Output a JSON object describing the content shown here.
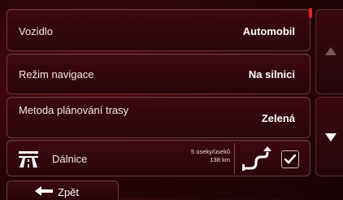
{
  "settings": {
    "vehicle": {
      "label": "Vozidlo",
      "value": "Automobil"
    },
    "nav_mode": {
      "label": "Režim navigace",
      "value": "Na silnici"
    },
    "route_method": {
      "label": "Metoda plánování trasy",
      "value": "Zelená"
    },
    "highways": {
      "label": "Dálnice",
      "info_line1": "5 úseky/úseků",
      "info_line2": "138 km",
      "checked": true
    }
  },
  "footer": {
    "back_label": "Zpět"
  },
  "colors": {
    "accent": "#e0202a",
    "background": "#2a0508"
  },
  "icons": [
    "highway-icon",
    "route-icon",
    "checkmark-icon",
    "triangle-up-icon",
    "triangle-down-icon",
    "arrow-left-icon"
  ]
}
